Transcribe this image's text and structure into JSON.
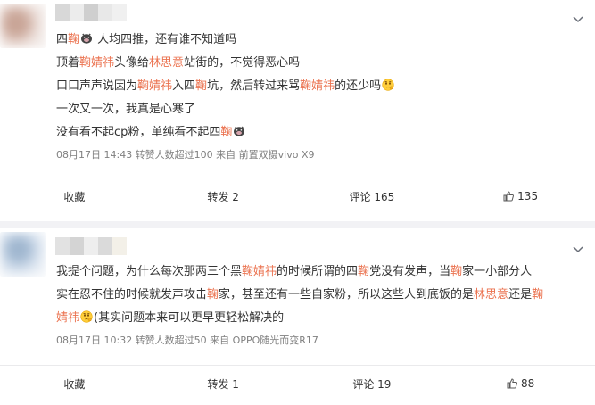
{
  "posts": [
    {
      "lines": [
        [
          {
            "t": "四"
          },
          {
            "t": "鞠",
            "hl": true
          },
          {
            "emoji": "pig-face-icon"
          },
          {
            "t": " 人均四推，还有谁不知道吗"
          }
        ],
        [
          {
            "t": "顶着"
          },
          {
            "t": "鞠婧祎",
            "hl": true
          },
          {
            "t": "头像给"
          },
          {
            "t": "林思意",
            "hl": true
          },
          {
            "t": "站街的，不觉得恶心吗"
          }
        ],
        [
          {
            "t": "口口声声说因为"
          },
          {
            "t": "鞠婧祎",
            "hl": true
          },
          {
            "t": "入四"
          },
          {
            "t": "鞠",
            "hl": true
          },
          {
            "t": "坑，然后转过来骂"
          },
          {
            "t": "鞠婧祎",
            "hl": true
          },
          {
            "t": "的还少吗"
          },
          {
            "emoji": "thinking-face-icon"
          }
        ],
        [
          {
            "t": "一次又一次，我真是心寒了"
          }
        ],
        [
          {
            "t": "没有看不起cp粉，单纯看不起四"
          },
          {
            "t": "鞠",
            "hl": true
          },
          {
            "emoji": "pig-face-icon"
          }
        ]
      ],
      "meta": "08月17日 14:43 转赞人数超过100  来自 前置双摄vivo X9",
      "actions": {
        "collect": "收藏",
        "repost": "转发 2",
        "comment": "评论 165",
        "like": "135"
      }
    },
    {
      "lines": [
        [
          {
            "t": "我提个问题，为什么每次那两三个黑"
          },
          {
            "t": "鞠婧祎",
            "hl": true
          },
          {
            "t": "的时候所谓的四"
          },
          {
            "t": "鞠",
            "hl": true
          },
          {
            "t": "党没有发声，当"
          },
          {
            "t": "鞠",
            "hl": true
          },
          {
            "t": "家一小部分人"
          }
        ],
        [
          {
            "t": "实在忍不住的时候就发声攻击"
          },
          {
            "t": "鞠",
            "hl": true
          },
          {
            "t": "家，甚至还有一些自家粉，所以这些人到底饭的是"
          },
          {
            "t": "林思意",
            "hl": true
          },
          {
            "t": "还是"
          },
          {
            "t": "鞠",
            "hl": true
          }
        ],
        [
          {
            "t": "婧祎",
            "hl": true
          },
          {
            "emoji": "thinking-face-icon"
          },
          {
            "t": "(其实问题本来可以更早更轻松解决的"
          }
        ]
      ],
      "meta": "08月17日 10:32 转赞人数超过50  来自 OPPO随光而变R17",
      "actions": {
        "collect": "收藏",
        "repost": "转发 1",
        "comment": "评论 19",
        "like": "88"
      }
    }
  ],
  "colors": {
    "highlight": "#eb7350",
    "meta": "#808080",
    "text": "#333333",
    "background": "#f2f2f5"
  }
}
